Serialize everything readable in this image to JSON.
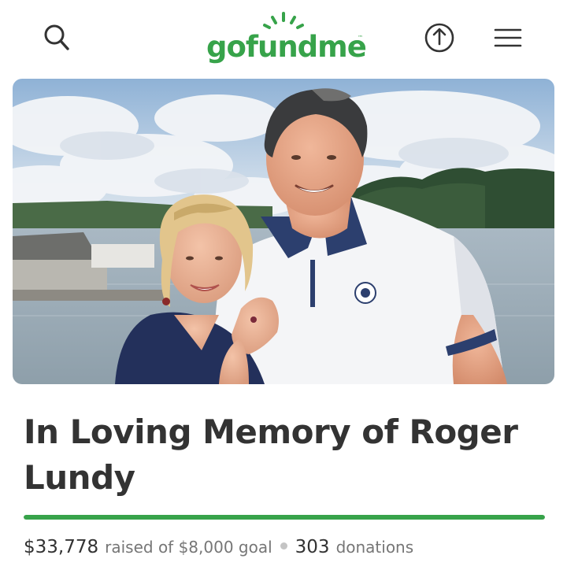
{
  "header": {
    "logo_text": "gofundme",
    "logo_tm": "™",
    "icons": [
      "search-icon",
      "share-icon",
      "menu-icon"
    ]
  },
  "colors": {
    "brand_green": "#37a34a",
    "text_dark": "#333333",
    "text_muted": "#767676",
    "track": "#e6e6e6"
  },
  "campaign": {
    "title": "In Loving Memory of Roger Lundy",
    "raised_amount": "$33,778",
    "raised_text": "raised of $8,000 goal",
    "donation_count": "303",
    "donations_label": "donations",
    "progress_fraction": 1.0
  }
}
